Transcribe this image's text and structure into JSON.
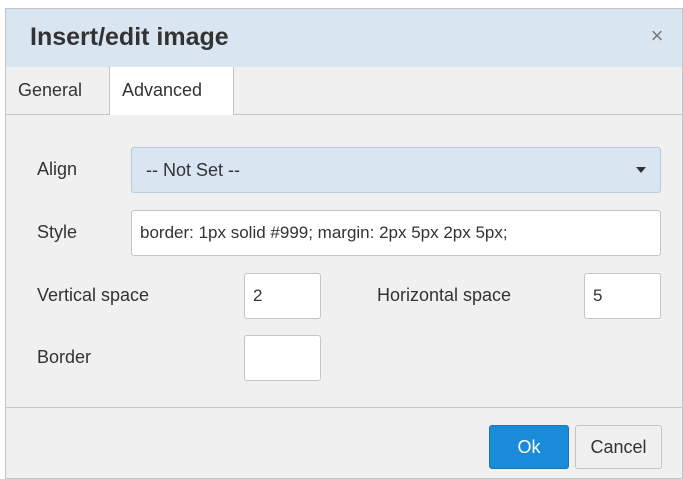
{
  "dialog": {
    "title": "Insert/edit image",
    "close_glyph": "×",
    "close_icon": "close-icon"
  },
  "tabs": [
    {
      "label": "General",
      "active": false
    },
    {
      "label": "Advanced",
      "active": true
    }
  ],
  "form": {
    "align": {
      "label": "Align",
      "value": "-- Not Set --"
    },
    "style": {
      "label": "Style",
      "value": "border: 1px solid #999; margin: 2px 5px 2px 5px;"
    },
    "vspace": {
      "label": "Vertical space",
      "value": "2"
    },
    "hspace": {
      "label": "Horizontal space",
      "value": "5"
    },
    "border": {
      "label": "Border",
      "value": ""
    }
  },
  "buttons": {
    "ok": "Ok",
    "cancel": "Cancel"
  },
  "colors": {
    "header_bg": "#d9e6f2",
    "body_bg": "#f0f0f0",
    "primary": "#1a8bd8"
  }
}
